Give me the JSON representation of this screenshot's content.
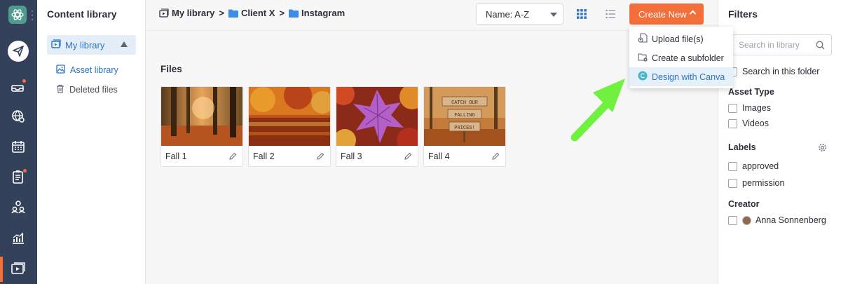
{
  "rail": {
    "icons": [
      "app-logo",
      "compose",
      "inbox",
      "listening",
      "calendar",
      "reports-list",
      "audience",
      "analytics",
      "content-library"
    ]
  },
  "library": {
    "title": "Content library",
    "my_library": "My library",
    "asset_library": "Asset library",
    "deleted_files": "Deleted files"
  },
  "breadcrumb": {
    "root": "My library",
    "level1": "Client X",
    "level2": "Instagram",
    "separator": ">"
  },
  "toolbar": {
    "sort_value": "Name: A-Z",
    "create_label": "Create New"
  },
  "create_menu": {
    "items": [
      {
        "label": "Upload file(s)",
        "icon": "upload-file-icon"
      },
      {
        "label": "Create a subfolder",
        "icon": "folder-plus-icon"
      },
      {
        "label": "Design with Canva",
        "icon": "canva-icon"
      }
    ]
  },
  "files": {
    "heading": "Files",
    "items": [
      {
        "name": "Fall 1"
      },
      {
        "name": "Fall 2"
      },
      {
        "name": "Fall 3"
      },
      {
        "name": "Fall 4"
      }
    ],
    "sign_lines": [
      "CATCH OUR",
      "FALLING",
      "PRICES!"
    ]
  },
  "filters": {
    "title": "Filters",
    "search_placeholder": "Search in library",
    "search_in_folder": "Search in this folder",
    "asset_type": {
      "title": "Asset Type",
      "options": [
        "Images",
        "Videos"
      ]
    },
    "labels": {
      "title": "Labels",
      "options": [
        "approved",
        "permission"
      ]
    },
    "creator": {
      "title": "Creator",
      "name": "Anna Sonnenberg"
    }
  },
  "colors": {
    "accent": "#f26f3a",
    "rail": "#33415a",
    "link": "#2d73c6",
    "annotation_arrow": "#6ff13d"
  }
}
